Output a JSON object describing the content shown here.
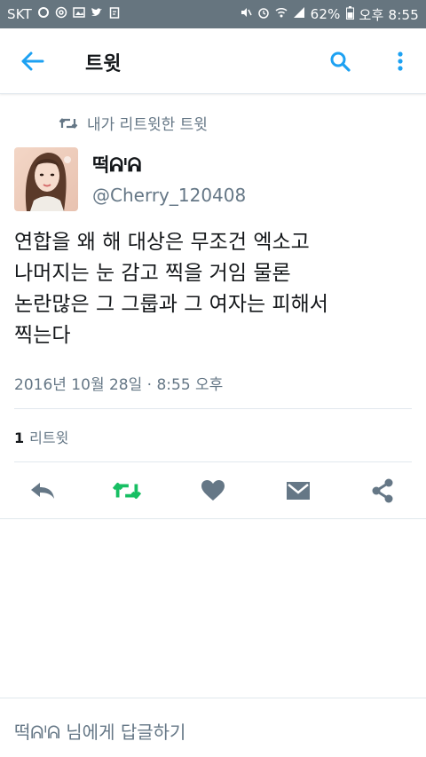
{
  "status_bar": {
    "carrier": "SKT",
    "battery": "62%",
    "time": "오후 8:55"
  },
  "app_bar": {
    "title": "트윗"
  },
  "retweet_context": {
    "label": "내가 리트윗한 트윗"
  },
  "tweet": {
    "display_name": "떡ᕱᑊᕱ",
    "handle": "@Cherry_120408",
    "text_lines": [
      "연합을 왜 해 대상은 무조건 엑소고",
      "나머지는 눈 감고 찍을 거임 물론",
      "논란많은 그 그룹과 그 여자는 피해서",
      "찍는다"
    ],
    "timestamp": "2016년 10월 28일 · 8:55 오후",
    "retweet_count": "1",
    "retweet_label": "리트윗"
  },
  "reply_bar": {
    "placeholder": "떡ᕱᑊᕱ 님에게 답글하기"
  },
  "colors": {
    "status_bar": "#66757f",
    "accent_blue": "#1da1f2",
    "retweet_green": "#17bf63",
    "icon_gray": "#657786",
    "text_primary": "#14171a",
    "text_secondary": "#657786"
  }
}
